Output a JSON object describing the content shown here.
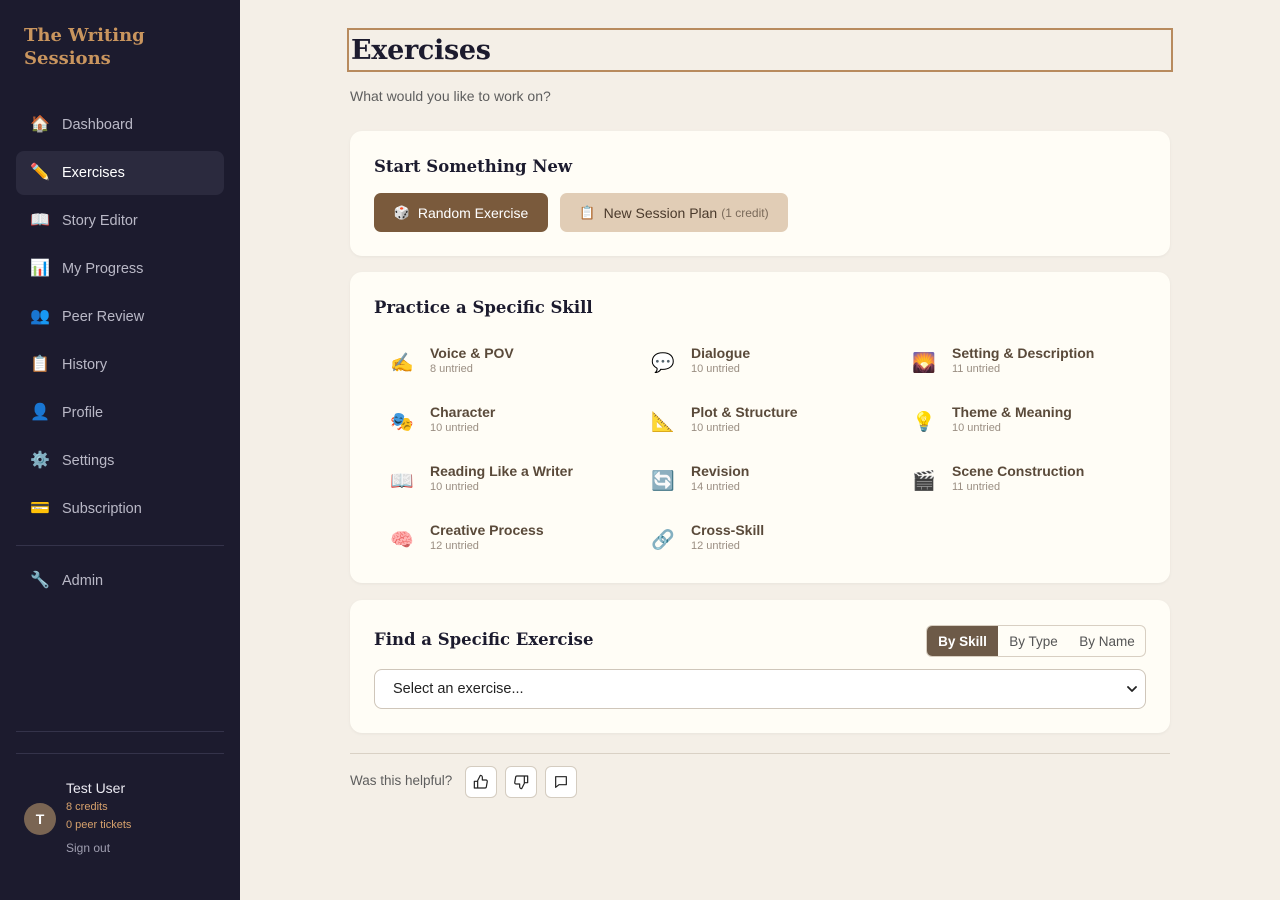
{
  "app": {
    "brand": "The Writing Sessions"
  },
  "sidebar": {
    "items": [
      {
        "label": "Dashboard",
        "icon": "🏠",
        "icon_name": "house-icon",
        "active": false
      },
      {
        "label": "Exercises",
        "icon": "✏️",
        "icon_name": "pencil-icon",
        "active": true
      },
      {
        "label": "Story Editor",
        "icon": "📖",
        "icon_name": "open-book-icon",
        "active": false
      },
      {
        "label": "My Progress",
        "icon": "📊",
        "icon_name": "bar-chart-icon",
        "active": false
      },
      {
        "label": "Peer Review",
        "icon": "👥",
        "icon_name": "people-icon",
        "active": false
      },
      {
        "label": "History",
        "icon": "📋",
        "icon_name": "clipboard-icon",
        "active": false
      },
      {
        "label": "Profile",
        "icon": "👤",
        "icon_name": "person-icon",
        "active": false
      },
      {
        "label": "Settings",
        "icon": "⚙️",
        "icon_name": "gear-icon",
        "active": false
      },
      {
        "label": "Subscription",
        "icon": "💳",
        "icon_name": "credit-card-icon",
        "active": false
      }
    ],
    "admin": {
      "label": "Admin",
      "icon": "🔧",
      "icon_name": "wrench-icon"
    },
    "user": {
      "initial": "T",
      "name": "Test User",
      "credits": "8 credits",
      "peer_tickets": "0 peer tickets",
      "sign_out": "Sign out"
    }
  },
  "main": {
    "title": "Exercises",
    "subtitle": "What would you like to work on?",
    "start_card": {
      "title": "Start Something New",
      "random_button": {
        "icon": "🎲",
        "label": "Random Exercise"
      },
      "session_button": {
        "icon": "📋",
        "label": "New Session Plan",
        "note": "(1 credit)"
      }
    },
    "skills_card": {
      "title": "Practice a Specific Skill",
      "skills": [
        {
          "name": "Voice & POV",
          "count": "8 untried",
          "icon": "✍️",
          "icon_name": "writing-hand-icon"
        },
        {
          "name": "Dialogue",
          "count": "10 untried",
          "icon": "💬",
          "icon_name": "speech-bubble-icon"
        },
        {
          "name": "Setting & Description",
          "count": "11 untried",
          "icon": "🌄",
          "icon_name": "landscape-icon"
        },
        {
          "name": "Character",
          "count": "10 untried",
          "icon": "🎭",
          "icon_name": "theater-masks-icon"
        },
        {
          "name": "Plot & Structure",
          "count": "10 untried",
          "icon": "📐",
          "icon_name": "triangle-ruler-icon"
        },
        {
          "name": "Theme & Meaning",
          "count": "10 untried",
          "icon": "💡",
          "icon_name": "light-bulb-icon"
        },
        {
          "name": "Reading Like a Writer",
          "count": "10 untried",
          "icon": "📖",
          "icon_name": "open-book-icon"
        },
        {
          "name": "Revision",
          "count": "14 untried",
          "icon": "🔄",
          "icon_name": "refresh-icon"
        },
        {
          "name": "Scene Construction",
          "count": "11 untried",
          "icon": "🎬",
          "icon_name": "clapper-board-icon"
        },
        {
          "name": "Creative Process",
          "count": "12 untried",
          "icon": "🧠",
          "icon_name": "brain-icon"
        },
        {
          "name": "Cross-Skill",
          "count": "12 untried",
          "icon": "🔗",
          "icon_name": "link-icon"
        }
      ]
    },
    "find_card": {
      "title": "Find a Specific Exercise",
      "tabs": [
        {
          "label": "By Skill",
          "active": true
        },
        {
          "label": "By Type",
          "active": false
        },
        {
          "label": "By Name",
          "active": false
        }
      ],
      "select_value": "Select an exercise..."
    },
    "feedback": {
      "label": "Was this helpful?"
    }
  },
  "colors": {
    "sidebar_bg": "#1c1b2e",
    "brand": "#c9955e",
    "page_bg": "#f4efe7",
    "card_bg": "#fffdf6",
    "primary_button": "#7a5a3c",
    "secondary_button": "#e1cdb6",
    "active_tab": "#6d5a48"
  }
}
